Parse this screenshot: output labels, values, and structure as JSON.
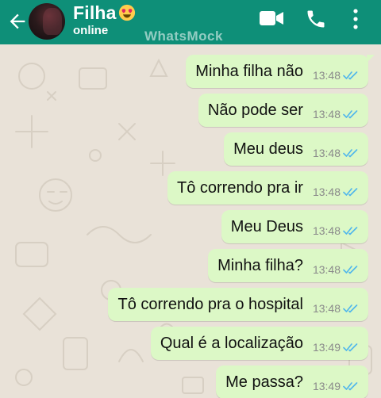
{
  "header": {
    "contact_name": "Filha",
    "status": "online",
    "watermark": "WhatsMock",
    "icons": [
      "back-arrow-icon",
      "heart-eyes-emoji-icon",
      "video-call-icon",
      "phone-call-icon",
      "more-options-icon"
    ]
  },
  "colors": {
    "header_bg": "#0e8f78",
    "outgoing_bubble": "#dcf8c6",
    "chat_bg": "#e9e2d8",
    "read_ticks": "#4fb6ec"
  },
  "messages": [
    {
      "text": "Minha filha não",
      "time": "13:48",
      "status": "read"
    },
    {
      "text": "Não pode ser",
      "time": "13:48",
      "status": "read"
    },
    {
      "text": "Meu deus",
      "time": "13:48",
      "status": "read"
    },
    {
      "text": "Tô correndo pra ir",
      "time": "13:48",
      "status": "read"
    },
    {
      "text": "Meu Deus",
      "time": "13:48",
      "status": "read"
    },
    {
      "text": "Minha filha?",
      "time": "13:48",
      "status": "read"
    },
    {
      "text": "Tô correndo pra o hospital",
      "time": "13:48",
      "status": "read"
    },
    {
      "text": "Qual é a localização",
      "time": "13:49",
      "status": "read"
    },
    {
      "text": "Me passa?",
      "time": "13:49",
      "status": "read"
    }
  ]
}
